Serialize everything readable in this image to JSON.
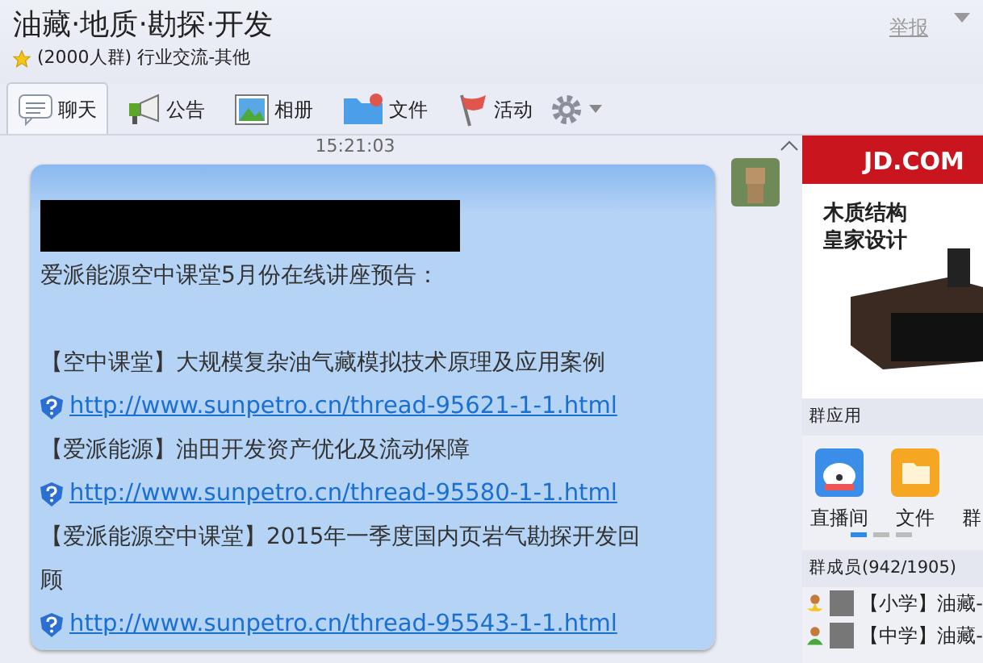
{
  "window": {
    "title": "油藏·地质·勘探·开发",
    "subtitle": "(2000人群) 行业交流-其他",
    "starred": true,
    "report": "举报"
  },
  "tabs": [
    {
      "label": "聊天",
      "selected": true
    },
    {
      "label": "公告",
      "selected": false
    },
    {
      "label": "相册",
      "selected": false
    },
    {
      "label": "文件",
      "selected": false
    },
    {
      "label": "活动",
      "selected": false
    }
  ],
  "chat": {
    "timestamp": "15:21:03",
    "message": {
      "redacted": true,
      "lines": [
        {
          "kind": "text",
          "text": "爱派能源空中课堂5月份在线讲座预告："
        },
        {
          "kind": "blank"
        },
        {
          "kind": "text",
          "text": "【空中课堂】大规模复杂油气藏模拟技术原理及应用案例"
        },
        {
          "kind": "link",
          "text": "http://www.sunpetro.cn/thread-95621-1-1.html"
        },
        {
          "kind": "text",
          "text": "【爱派能源】油田开发资产优化及流动保障"
        },
        {
          "kind": "link",
          "text": "http://www.sunpetro.cn/thread-95580-1-1.html"
        },
        {
          "kind": "text",
          "text": "【爱派能源空中课堂】2015年一季度国内页岩气勘探开发回顾"
        },
        {
          "kind": "link",
          "text": "http://www.sunpetro.cn/thread-95543-1-1.html"
        }
      ]
    }
  },
  "ad": {
    "brand": "JD.COM",
    "lines": [
      "木质结构",
      "皇家设计"
    ]
  },
  "apps": {
    "title": "群应用",
    "items": [
      {
        "label": "直播间"
      },
      {
        "label": "文件"
      },
      {
        "label": "群"
      }
    ],
    "pages": [
      {
        "selected": true
      },
      {
        "selected": false
      },
      {
        "selected": false
      }
    ]
  },
  "members": {
    "title": "群成员(942/1905)",
    "items": [
      {
        "kind": "admin",
        "name": "【小学】油藏-"
      },
      {
        "kind": "member",
        "name": "【中学】油藏-"
      }
    ]
  }
}
